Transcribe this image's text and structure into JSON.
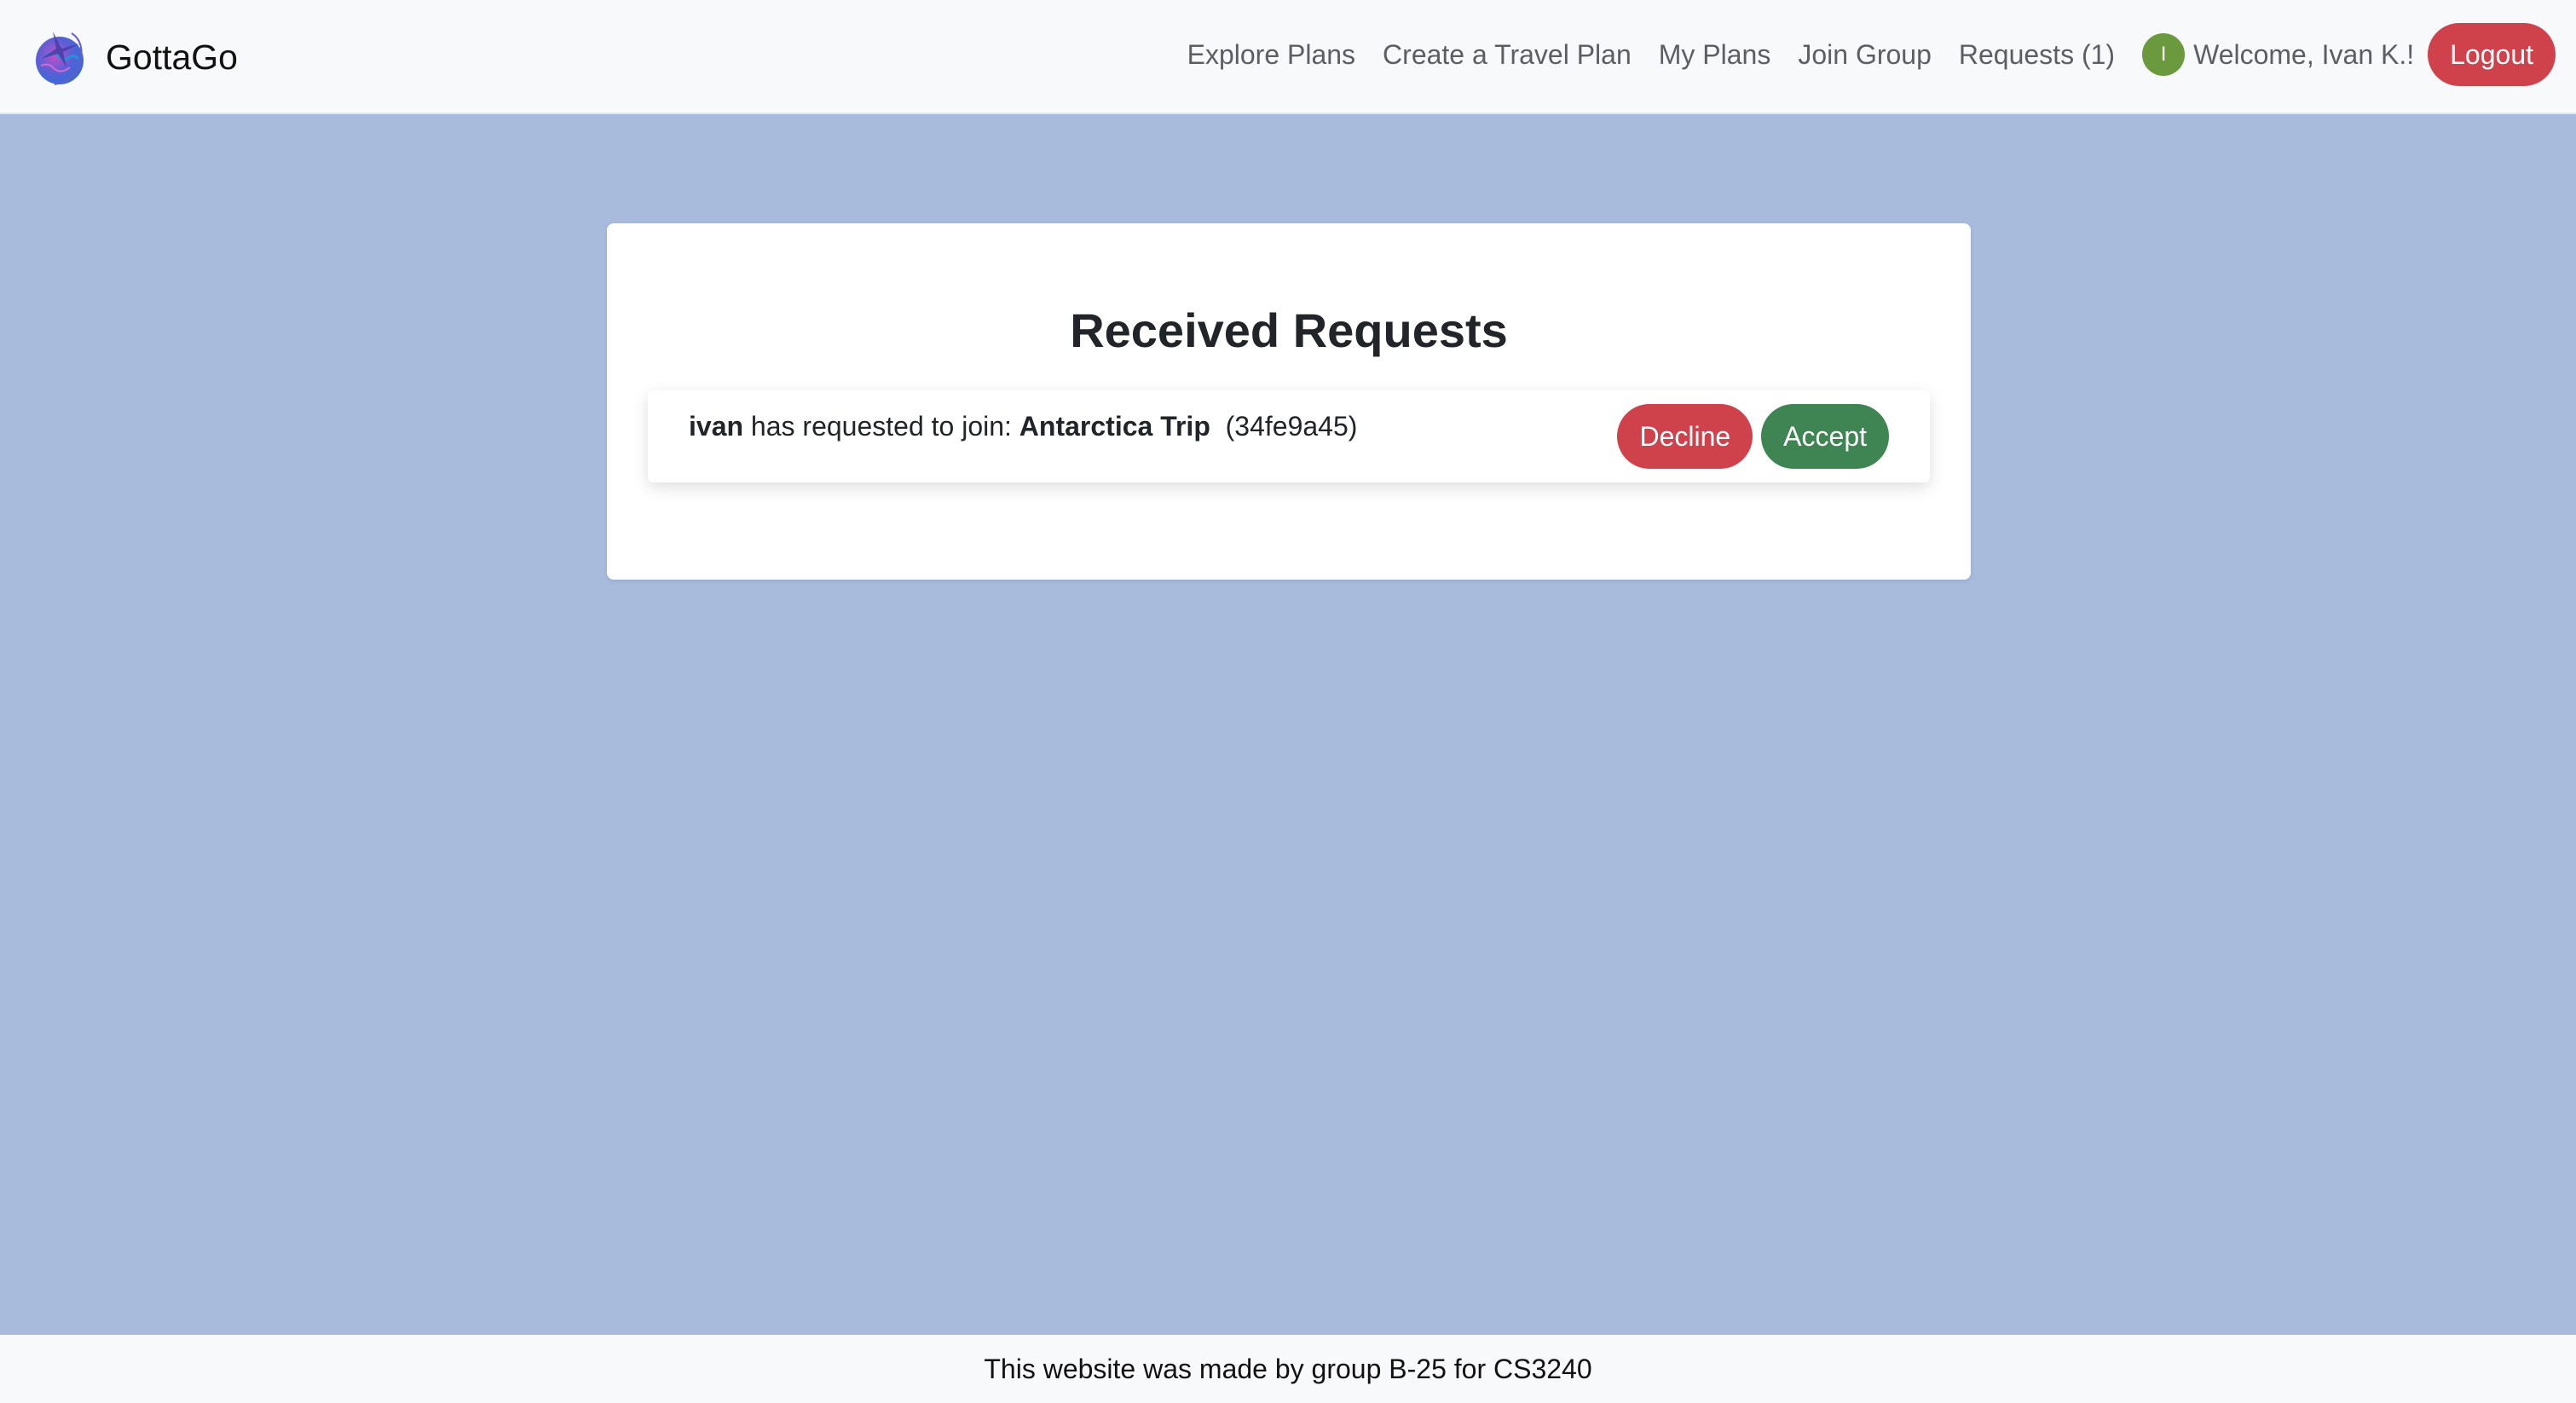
{
  "brand": {
    "name": "GottaGo"
  },
  "nav": {
    "links": [
      "Explore Plans",
      "Create a Travel Plan",
      "My Plans",
      "Join Group",
      "Requests (1)"
    ],
    "avatar_initial": "I",
    "welcome": "Welcome, Ivan K.!",
    "logout": "Logout"
  },
  "main": {
    "title": "Received Requests",
    "requests": [
      {
        "user": "ivan",
        "text": " has requested to join: ",
        "plan": "Antarctica Trip",
        "code": "  (34fe9a45)",
        "decline": "Decline",
        "accept": "Accept"
      }
    ]
  },
  "footer": {
    "text": "This website was made by group B-25 for CS3240"
  },
  "colors": {
    "background": "#a8bbdc",
    "danger": "#d0424b",
    "success": "#3f8553",
    "avatar": "#6b9a3e"
  }
}
